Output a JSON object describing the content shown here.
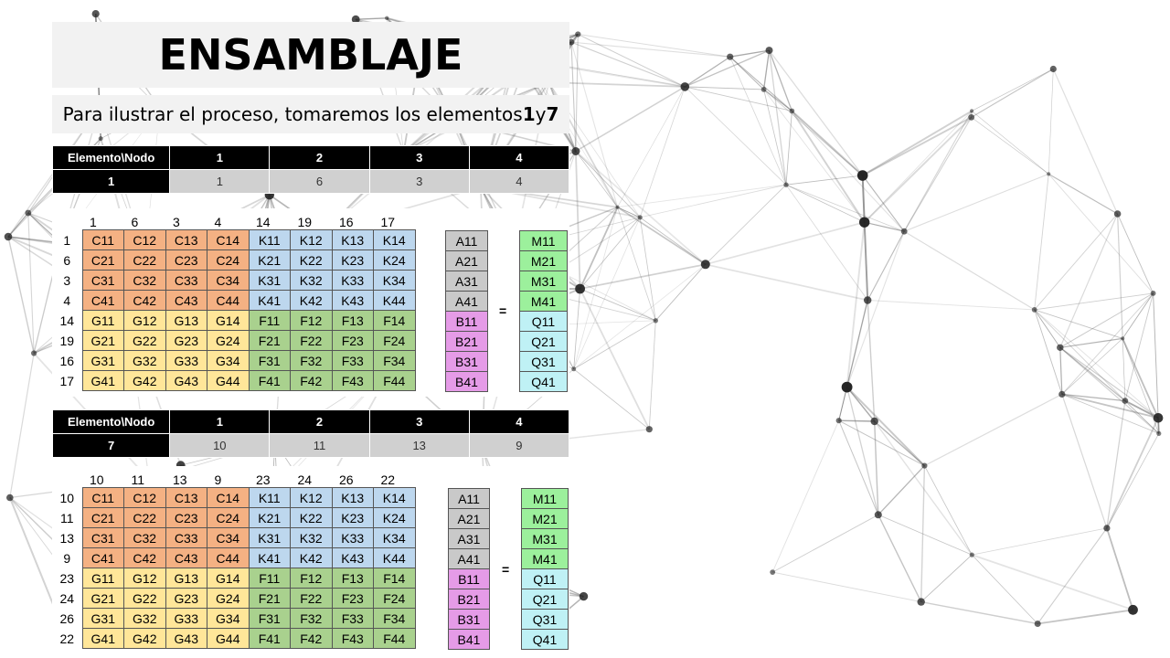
{
  "slide": {
    "title": "ENSAMBLAJE",
    "subtitle_text": "Para ilustrar el proceso, tomaremos los elementos ",
    "subtitle_el1": "1",
    "subtitle_and": " y ",
    "subtitle_el2": "7"
  },
  "blocks": [
    {
      "node_table": {
        "header": [
          "Elemento\\Nodo",
          "1",
          "2",
          "3",
          "4"
        ],
        "element": "1",
        "nodes": [
          "1",
          "6",
          "3",
          "4"
        ]
      },
      "col_labels": [
        "1",
        "6",
        "3",
        "4",
        "14",
        "19",
        "16",
        "17"
      ],
      "row_labels": [
        "1",
        "6",
        "3",
        "4",
        "14",
        "19",
        "16",
        "17"
      ]
    },
    {
      "node_table": {
        "header": [
          "Elemento\\Nodo",
          "1",
          "2",
          "3",
          "4"
        ],
        "element": "7",
        "nodes": [
          "10",
          "11",
          "13",
          "9"
        ]
      },
      "col_labels": [
        "10",
        "11",
        "13",
        "9",
        "23",
        "24",
        "26",
        "22"
      ],
      "row_labels": [
        "10",
        "11",
        "13",
        "9",
        "23",
        "24",
        "26",
        "22"
      ]
    }
  ],
  "matrix": [
    [
      "C11",
      "C12",
      "C13",
      "C14",
      "K11",
      "K12",
      "K13",
      "K14"
    ],
    [
      "C21",
      "C22",
      "C23",
      "C24",
      "K21",
      "K22",
      "K23",
      "K24"
    ],
    [
      "C31",
      "C32",
      "C33",
      "C34",
      "K31",
      "K32",
      "K33",
      "K34"
    ],
    [
      "C41",
      "C42",
      "C43",
      "C44",
      "K41",
      "K42",
      "K43",
      "K44"
    ],
    [
      "G11",
      "G12",
      "G13",
      "G14",
      "F11",
      "F12",
      "F13",
      "F14"
    ],
    [
      "G21",
      "G22",
      "G23",
      "G24",
      "F21",
      "F22",
      "F23",
      "F24"
    ],
    [
      "G31",
      "G32",
      "G33",
      "G34",
      "F31",
      "F32",
      "F33",
      "F34"
    ],
    [
      "G41",
      "G42",
      "G43",
      "G44",
      "F41",
      "F42",
      "F43",
      "F44"
    ]
  ],
  "vector_u": [
    "A11",
    "A21",
    "A31",
    "A41",
    "B11",
    "B21",
    "B31",
    "B41"
  ],
  "vector_rhs": [
    "M11",
    "M21",
    "M31",
    "M41",
    "Q11",
    "Q21",
    "Q31",
    "Q41"
  ],
  "equals": "=",
  "colors": {
    "C": "#f4b183",
    "K": "#bdd7ee",
    "G": "#ffe699",
    "F": "#a9d18e",
    "A": "#c9c9c9",
    "B": "#e59be7",
    "M": "#9cf09c",
    "Q": "#bff1f5"
  }
}
